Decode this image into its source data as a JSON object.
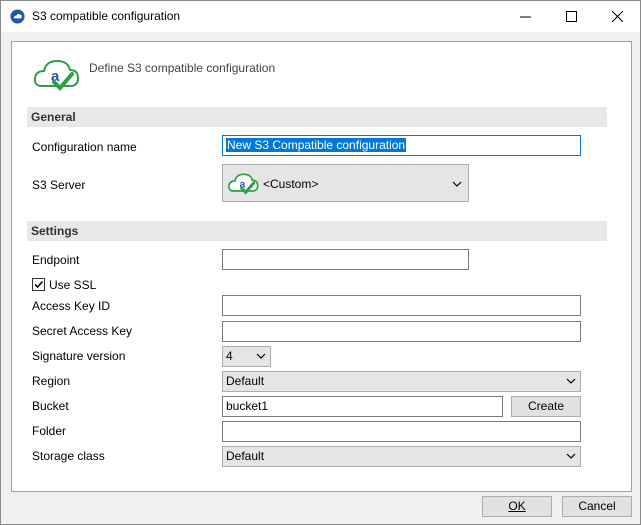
{
  "window": {
    "title": "S3 compatible configuration"
  },
  "header": {
    "text": "Define S3 compatible configuration"
  },
  "general": {
    "heading": "General",
    "config_name_label": "Configuration name",
    "config_name_value": "New S3 Compatible configuration",
    "s3_server_label": "S3 Server",
    "s3_server_value": "<Custom>"
  },
  "settings": {
    "heading": "Settings",
    "endpoint_label": "Endpoint",
    "endpoint_value": "",
    "use_ssl_label": "Use SSL",
    "use_ssl_checked": true,
    "access_key_label": "Access Key ID",
    "access_key_value": "",
    "secret_key_label": "Secret Access Key",
    "secret_key_value": "",
    "signature_label": "Signature version",
    "signature_value": "4",
    "region_label": "Region",
    "region_value": "Default",
    "bucket_label": "Bucket",
    "bucket_value": "bucket1",
    "create_label": "Create",
    "folder_label": "Folder",
    "folder_value": "",
    "storage_class_label": "Storage class",
    "storage_class_value": "Default"
  },
  "footer": {
    "ok_label": "OK",
    "cancel_label": "Cancel"
  },
  "colors": {
    "accent": "#0078d7",
    "section_bg": "#e8e8e8",
    "cloud_green": "#2e9e48"
  }
}
